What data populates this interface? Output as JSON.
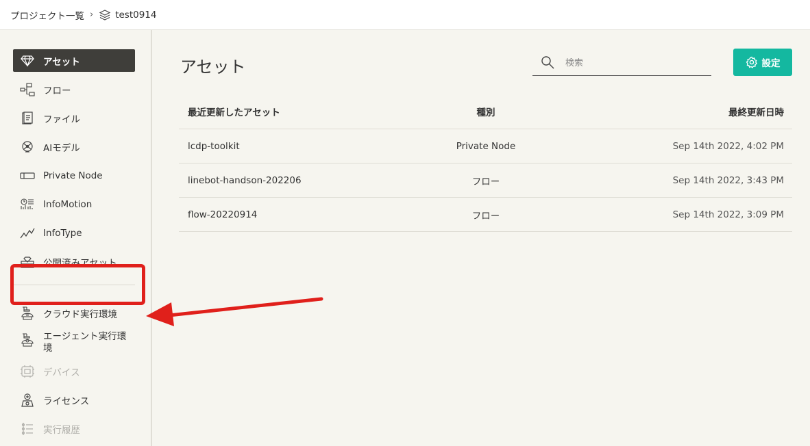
{
  "breadcrumb": {
    "root": "プロジェクト一覧",
    "separator": "›",
    "project_icon": "layers-icon",
    "project": "test0914"
  },
  "sidebar": {
    "items": [
      {
        "label": "アセット",
        "icon": "diamond-icon",
        "state": "active"
      },
      {
        "label": "フロー",
        "icon": "flow-icon",
        "state": "normal"
      },
      {
        "label": "ファイル",
        "icon": "file-icon",
        "state": "normal"
      },
      {
        "label": "AIモデル",
        "icon": "ai-model-icon",
        "state": "normal"
      },
      {
        "label": "Private Node",
        "icon": "private-node-icon",
        "state": "normal"
      },
      {
        "label": "InfoMotion",
        "icon": "infomotion-icon",
        "state": "normal"
      },
      {
        "label": "InfoType",
        "icon": "infotype-icon",
        "state": "normal"
      },
      {
        "label": "公開済みアセット",
        "icon": "published-asset-icon",
        "state": "normal"
      },
      {
        "label": "クラウド実行環境",
        "icon": "cloud-runtime-icon",
        "state": "normal"
      },
      {
        "label": "エージェント実行環境",
        "icon": "agent-runtime-icon",
        "state": "normal"
      },
      {
        "label": "デバイス",
        "icon": "device-icon",
        "state": "disabled"
      },
      {
        "label": "ライセンス",
        "icon": "license-icon",
        "state": "normal"
      },
      {
        "label": "実行履歴",
        "icon": "history-icon",
        "state": "disabled"
      }
    ]
  },
  "main": {
    "title": "アセット",
    "search": {
      "placeholder": "検索",
      "value": "",
      "icon": "search-icon"
    },
    "settings_button": {
      "label": "設定",
      "icon": "gear-icon",
      "color": "#14b8a0"
    },
    "table": {
      "headers": [
        "最近更新したアセット",
        "種別",
        "最終更新日時"
      ],
      "rows": [
        [
          "lcdp-toolkit",
          "Private Node",
          "Sep 14th 2022, 4:02 PM"
        ],
        [
          "linebot-handson-202206",
          "フロー",
          "Sep 14th 2022, 3:43 PM"
        ],
        [
          "flow-20220914",
          "フロー",
          "Sep 14th 2022, 3:09 PM"
        ]
      ]
    }
  },
  "annotation": {
    "color": "#e0201b"
  }
}
